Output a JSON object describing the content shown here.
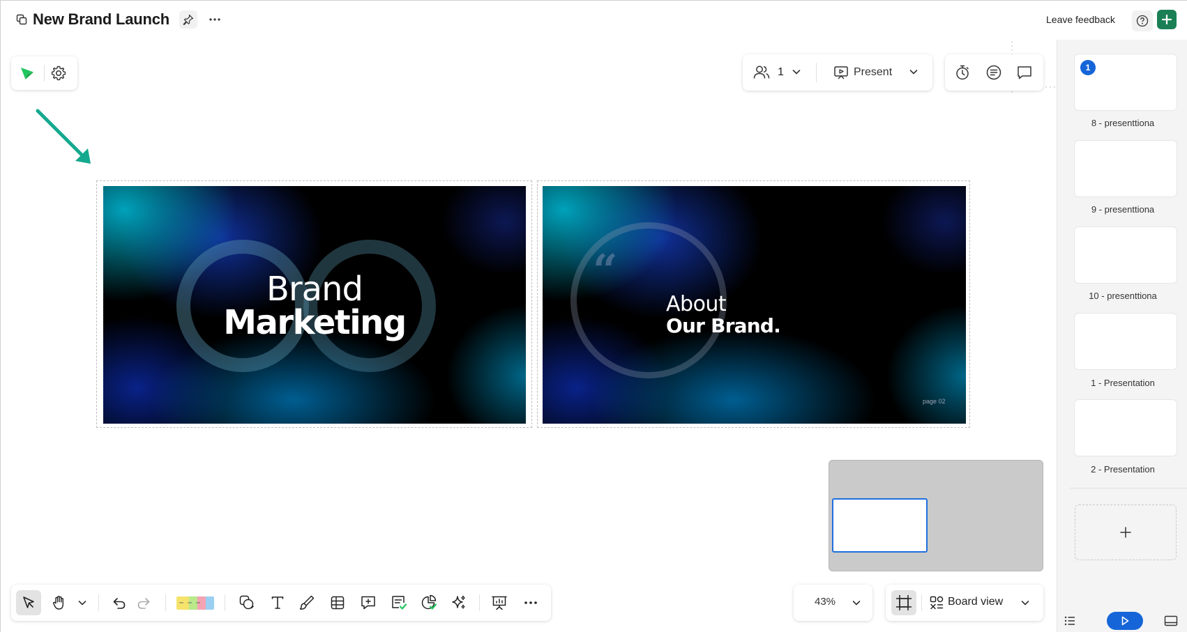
{
  "header": {
    "title": "New Brand Launch",
    "feedback_label": "Leave feedback"
  },
  "collaboration": {
    "count": "1",
    "present_label": "Present"
  },
  "slides": [
    {
      "line1": "Brand",
      "line2": "Marketing"
    },
    {
      "line1": "About",
      "line2": "Our Brand.",
      "quote": "“",
      "page_label": "page 02"
    }
  ],
  "zoom": {
    "level": "43%"
  },
  "view": {
    "label": "Board view"
  },
  "sidebar": {
    "items": [
      {
        "label": "8 - presenttiona",
        "badge": "1"
      },
      {
        "label": "9 - presenttiona"
      },
      {
        "label": "10 - presenttiona"
      },
      {
        "label": "1 - Presentation"
      },
      {
        "label": "2 - Presentation"
      }
    ]
  },
  "colors": {
    "accent_green": "#1a7f55",
    "arrow_teal": "#14a98e",
    "selection_blue": "#1565d8",
    "sticky_yellow": "#f5e36b",
    "sticky_green": "#b9e98a",
    "sticky_pink": "#f4a3b3",
    "sticky_blue": "#9bcff2"
  }
}
